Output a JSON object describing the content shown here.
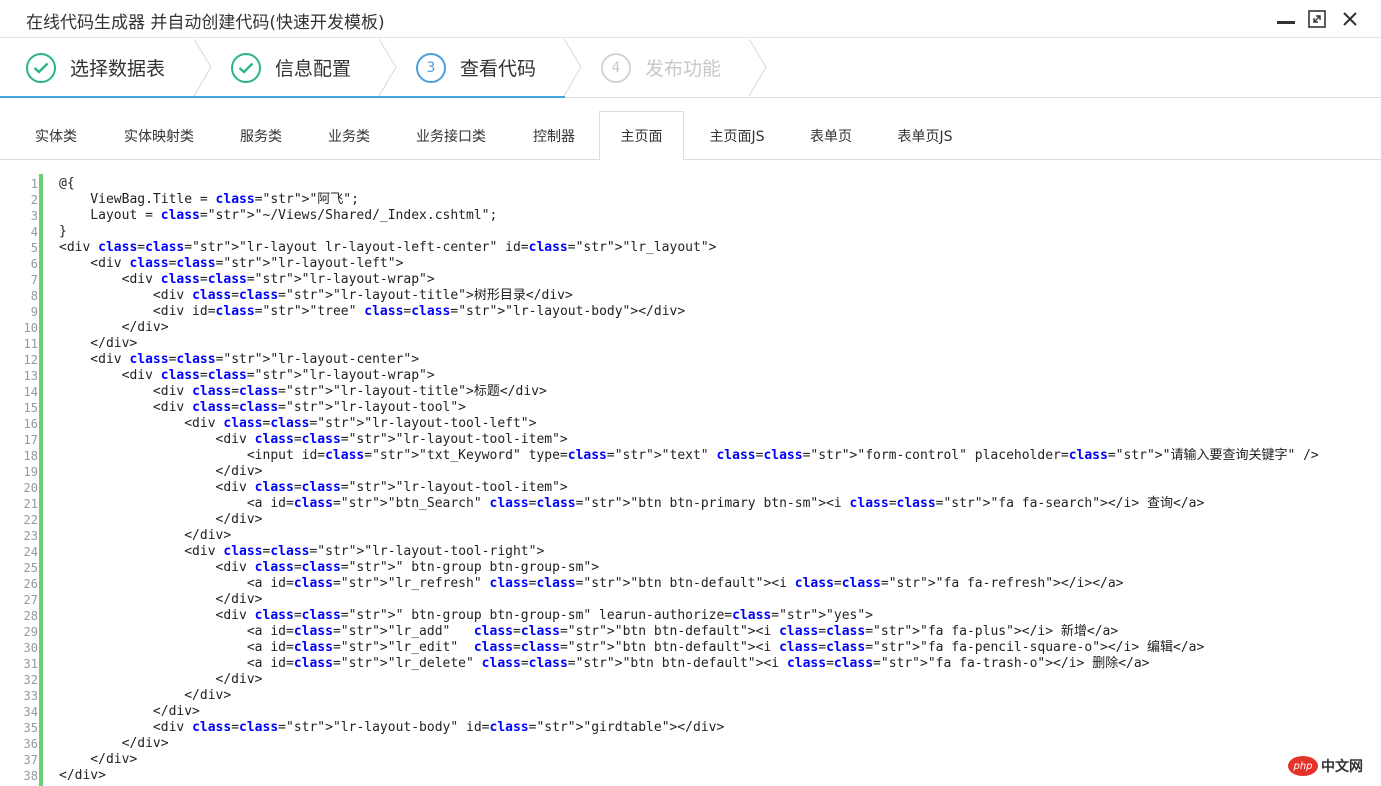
{
  "window": {
    "title": "在线代码生成器 并自动创建代码(快速开发模板)",
    "controls": [
      "minimize-icon",
      "maximize-icon",
      "close-icon"
    ]
  },
  "steps": [
    {
      "number": "1",
      "label": "选择数据表",
      "state": "done",
      "icon": "check-icon"
    },
    {
      "number": "2",
      "label": "信息配置",
      "state": "done",
      "icon": "check-icon"
    },
    {
      "number": "3",
      "label": "查看代码",
      "state": "active"
    },
    {
      "number": "4",
      "label": "发布功能",
      "state": "todo"
    }
  ],
  "tabs": [
    {
      "label": "实体类"
    },
    {
      "label": "实体映射类"
    },
    {
      "label": "服务类"
    },
    {
      "label": "业务类"
    },
    {
      "label": "业务接口类"
    },
    {
      "label": "控制器"
    },
    {
      "label": "主页面",
      "active": true
    },
    {
      "label": "主页面JS"
    },
    {
      "label": "表单页"
    },
    {
      "label": "表单页JS"
    }
  ],
  "code": {
    "line_numbers": [
      "1",
      "2",
      "3",
      "4",
      "5",
      "6",
      "7",
      "8",
      "9",
      "10",
      "11",
      "12",
      "13",
      "14",
      "15",
      "16",
      "17",
      "18",
      "19",
      "20",
      "21",
      "22",
      "23",
      "24",
      "25",
      "26",
      "27",
      "28",
      "29",
      "30",
      "31",
      "32",
      "33",
      "34",
      "35",
      "36",
      "37",
      "38"
    ],
    "lines": [
      "@{",
      "    ViewBag.Title = \"阿飞\";",
      "    Layout = \"~/Views/Shared/_Index.cshtml\";",
      "}",
      "<div class=\"lr-layout lr-layout-left-center\" id=\"lr_layout\">",
      "    <div class=\"lr-layout-left\">",
      "        <div class=\"lr-layout-wrap\">",
      "            <div class=\"lr-layout-title\">树形目录</div>",
      "            <div id=\"tree\" class=\"lr-layout-body\"></div>",
      "        </div>",
      "    </div>",
      "    <div class=\"lr-layout-center\">",
      "        <div class=\"lr-layout-wrap\">",
      "            <div class=\"lr-layout-title\">标题</div>",
      "            <div class=\"lr-layout-tool\">",
      "                <div class=\"lr-layout-tool-left\">",
      "                    <div class=\"lr-layout-tool-item\">",
      "                        <input id=\"txt_Keyword\" type=\"text\" class=\"form-control\" placeholder=\"请输入要查询关键字\" />",
      "                    </div>",
      "                    <div class=\"lr-layout-tool-item\">",
      "                        <a id=\"btn_Search\" class=\"btn btn-primary btn-sm\"><i class=\"fa fa-search\"></i> 查询</a>",
      "                    </div>",
      "                </div>",
      "                <div class=\"lr-layout-tool-right\">",
      "                    <div class=\" btn-group btn-group-sm\">",
      "                        <a id=\"lr_refresh\" class=\"btn btn-default\"><i class=\"fa fa-refresh\"></i></a>",
      "                    </div>",
      "                    <div class=\" btn-group btn-group-sm\" learun-authorize=\"yes\">",
      "                        <a id=\"lr_add\"   class=\"btn btn-default\"><i class=\"fa fa-plus\"></i> 新增</a>",
      "                        <a id=\"lr_edit\"  class=\"btn btn-default\"><i class=\"fa fa-pencil-square-o\"></i> 编辑</a>",
      "                        <a id=\"lr_delete\" class=\"btn btn-default\"><i class=\"fa fa-trash-o\"></i> 删除</a>",
      "                    </div>",
      "                </div>",
      "            </div>",
      "            <div class=\"lr-layout-body\" id=\"girdtable\"></div>",
      "        </div>",
      "    </div>",
      "</div>"
    ]
  },
  "watermark": {
    "logo": "php",
    "text": "中文网"
  },
  "colors": {
    "done": "#2bb38a",
    "active": "#4b9fda",
    "todo": "#c8c8c8",
    "gutter_bar": "#6ccf75",
    "keyword": "#0000ff",
    "string": "#1a1aa6"
  }
}
